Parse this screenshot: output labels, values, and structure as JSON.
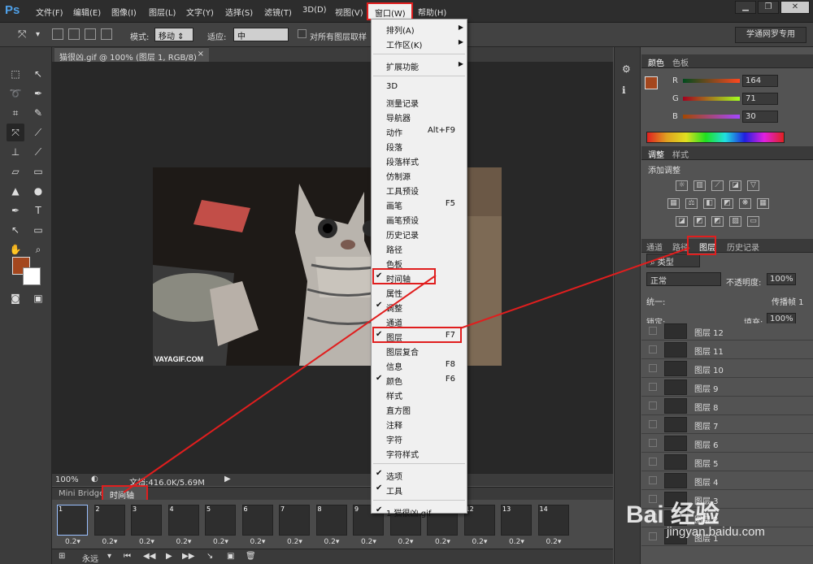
{
  "menubar": {
    "logo": "Ps",
    "items": [
      "文件(F)",
      "编辑(E)",
      "图像(I)",
      "图层(L)",
      "文字(Y)",
      "选择(S)",
      "滤镜(T)",
      "3D(D)",
      "视图(V)",
      "窗口(W)",
      "帮助(H)"
    ],
    "window_controls": [
      "▁",
      "❐",
      "✕"
    ]
  },
  "options": {
    "mode_label": "模式:",
    "mode_value": "移动",
    "fit_label": "适应:",
    "fit_value": "中",
    "sample_all_label": "对所有图层取样",
    "workspace": "学通网罗专用"
  },
  "document": {
    "tab_title": "猫很凶.gif @ 100% (图层 1, RGB/8)",
    "tab_close": "×",
    "watermark": "VAYAGIF.COM",
    "zoom": "100%",
    "doc_info": "文档:416.0K/5.69M"
  },
  "timeline": {
    "tabs": [
      "Mini Bridge",
      "时间轴"
    ],
    "frames": [
      {
        "num": "1",
        "delay": "0.2▾"
      },
      {
        "num": "2",
        "delay": "0.2▾"
      },
      {
        "num": "3",
        "delay": "0.2▾"
      },
      {
        "num": "4",
        "delay": "0.2▾"
      },
      {
        "num": "5",
        "delay": "0.2▾"
      },
      {
        "num": "6",
        "delay": "0.2▾"
      },
      {
        "num": "7",
        "delay": "0.2▾"
      },
      {
        "num": "8",
        "delay": "0.2▾"
      },
      {
        "num": "9",
        "delay": "0.2▾"
      },
      {
        "num": "10",
        "delay": "0.2▾"
      },
      {
        "num": "11",
        "delay": "0.2▾"
      },
      {
        "num": "12",
        "delay": "0.2▾"
      },
      {
        "num": "13",
        "delay": "0.2▾"
      },
      {
        "num": "14",
        "delay": "0.2▾"
      }
    ],
    "loop": "永远"
  },
  "color_panel": {
    "tabs": [
      "颜色",
      "色板"
    ],
    "r_label": "R",
    "r_value": "164",
    "g_label": "G",
    "g_value": "71",
    "b_label": "B",
    "b_value": "30",
    "fg_color": "#a4471e"
  },
  "adjust_panel": {
    "tabs": [
      "调整",
      "样式"
    ],
    "title": "添加调整"
  },
  "layers_panel": {
    "tabs": [
      "通道",
      "路径",
      "图层",
      "历史记录"
    ],
    "filter": "类型",
    "blend": "正常",
    "opacity_label": "不透明度:",
    "opacity": "100%",
    "unify_label": "统一:",
    "propagate_label": "传播帧 1",
    "lock_label": "锁定:",
    "fill_label": "填充:",
    "fill": "100%",
    "layers": [
      "图层 12",
      "图层 11",
      "图层 10",
      "图层 9",
      "图层 8",
      "图层 7",
      "图层 6",
      "图层 5",
      "图层 4",
      "图层 3",
      "图层 2",
      "图层 1"
    ]
  },
  "dropdown": {
    "items": [
      {
        "label": "排列(A)",
        "submenu": true
      },
      {
        "label": "工作区(K)",
        "submenu": true
      },
      {
        "sep": true
      },
      {
        "label": "扩展功能",
        "submenu": true
      },
      {
        "sep": true
      },
      {
        "label": "3D"
      },
      {
        "label": "测量记录"
      },
      {
        "label": "导航器"
      },
      {
        "label": "动作",
        "shortcut": "Alt+F9"
      },
      {
        "label": "段落"
      },
      {
        "label": "段落样式"
      },
      {
        "label": "仿制源"
      },
      {
        "label": "工具预设"
      },
      {
        "label": "画笔",
        "shortcut": "F5"
      },
      {
        "label": "画笔预设"
      },
      {
        "label": "历史记录"
      },
      {
        "label": "路径"
      },
      {
        "label": "色板"
      },
      {
        "label": "时间轴",
        "checked": true,
        "highlight": true
      },
      {
        "label": "属性"
      },
      {
        "label": "调整",
        "checked": true
      },
      {
        "label": "通道"
      },
      {
        "label": "图层",
        "shortcut": "F7",
        "checked": true,
        "highlight": true
      },
      {
        "label": "图层复合"
      },
      {
        "label": "信息",
        "shortcut": "F8"
      },
      {
        "label": "颜色",
        "shortcut": "F6",
        "checked": true
      },
      {
        "label": "样式"
      },
      {
        "label": "直方图"
      },
      {
        "label": "注释"
      },
      {
        "label": "字符"
      },
      {
        "label": "字符样式"
      },
      {
        "sep": true
      },
      {
        "label": "选项",
        "checked": true
      },
      {
        "label": "工具",
        "checked": true
      },
      {
        "sep": true
      },
      {
        "label": "1 猫很凶.gif",
        "checked": true
      }
    ]
  },
  "watermark": {
    "brand": "Bai 经验",
    "url": "jingyan.baidu.com"
  },
  "colors": {
    "accent_red": "#e01e1e",
    "panel_bg": "#535353",
    "menu_bg": "#f0f0f0"
  }
}
